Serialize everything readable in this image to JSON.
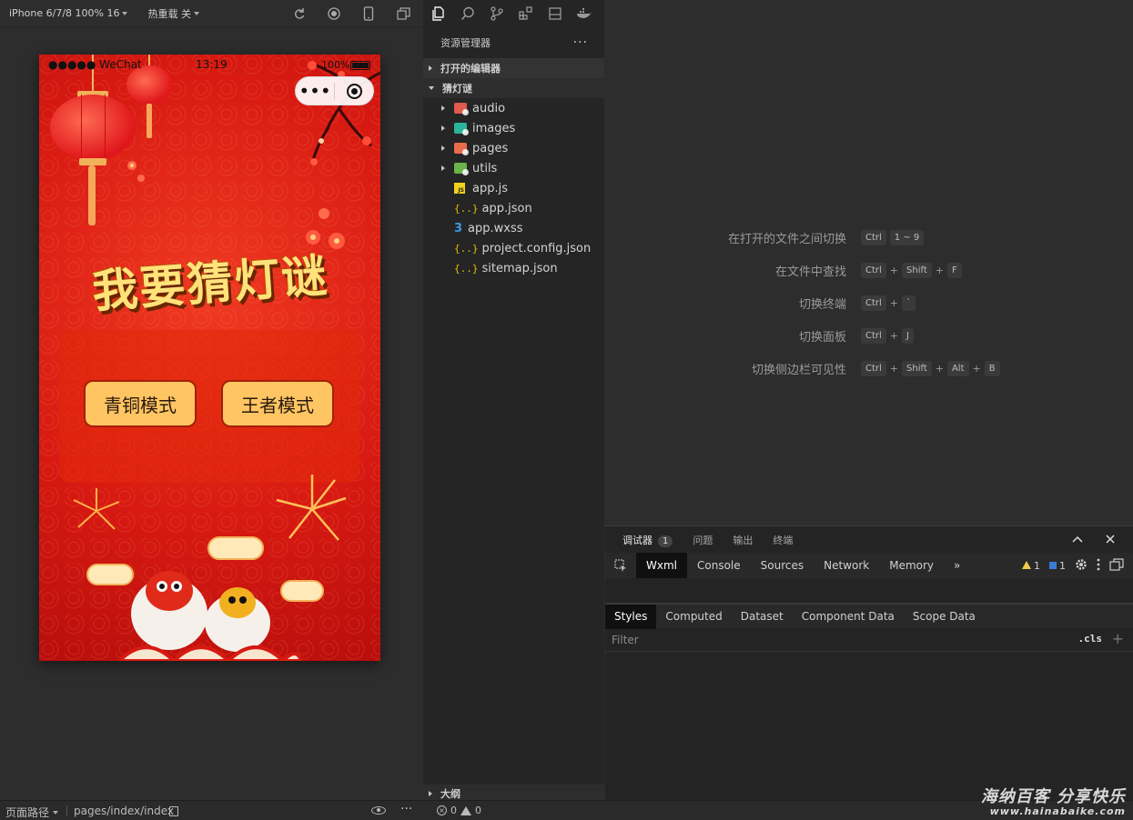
{
  "simulator": {
    "device_label": "iPhone 6/7/8 100% 16",
    "hot_reload_label": "热重载 关",
    "status_bar": {
      "signal": "●●●●● WeChat",
      "time": "13:19",
      "battery": "100%"
    },
    "capsule_more": "•••",
    "game": {
      "title": "我要猜灯谜",
      "buttons": [
        "青铜模式",
        "王者模式"
      ]
    }
  },
  "explorer": {
    "header": "资源管理器",
    "more": "···",
    "open_editors": "打开的编辑器",
    "project": "猜灯谜",
    "folders": [
      {
        "name": "audio",
        "color": "#e05a4e"
      },
      {
        "name": "images",
        "color": "#2bb59a"
      },
      {
        "name": "pages",
        "color": "#e96c4c"
      },
      {
        "name": "utils",
        "color": "#6bb34a"
      }
    ],
    "files": [
      {
        "name": "app.js",
        "icon": "js-file-icon"
      },
      {
        "name": "app.json",
        "icon": "json-file-icon"
      },
      {
        "name": "app.wxss",
        "icon": "css-file-icon"
      },
      {
        "name": "project.config.json",
        "icon": "json-file-icon"
      },
      {
        "name": "sitemap.json",
        "icon": "json-file-icon"
      }
    ],
    "outline": "大纲"
  },
  "welcome": {
    "shortcuts": [
      {
        "label": "在打开的文件之间切换",
        "keys": [
          "Ctrl",
          "1 ~ 9"
        ]
      },
      {
        "label": "在文件中查找",
        "keys": [
          "Ctrl",
          "Shift",
          "F"
        ]
      },
      {
        "label": "切换终端",
        "keys": [
          "Ctrl",
          "`"
        ]
      },
      {
        "label": "切换面板",
        "keys": [
          "Ctrl",
          "J"
        ]
      },
      {
        "label": "切换侧边栏可见性",
        "keys": [
          "Ctrl",
          "Shift",
          "Alt",
          "B"
        ]
      }
    ]
  },
  "debugger": {
    "tabs": [
      "调试器",
      "问题",
      "输出",
      "终端"
    ],
    "debugger_badge": "1",
    "devtools_tabs": [
      "Wxml",
      "Console",
      "Sources",
      "Network",
      "Memory"
    ],
    "overflow": "»",
    "warnings": "1",
    "messages": "1",
    "style_tabs": [
      "Styles",
      "Computed",
      "Dataset",
      "Component Data",
      "Scope Data"
    ],
    "filter_placeholder": "Filter",
    "cls": ".cls",
    "plus": "+"
  },
  "statusbar": {
    "page_path_label": "页面路径",
    "page_path": "pages/index/index",
    "more": "···",
    "errors": "0",
    "warnings": "0"
  },
  "watermark": {
    "line1": "海纳百客 分享快乐",
    "line2": "www.hainabaike.com"
  },
  "colors": {
    "accent_game_red": "#d81a12",
    "button_gold": "#ffc562",
    "panel_bg": "#252526"
  }
}
